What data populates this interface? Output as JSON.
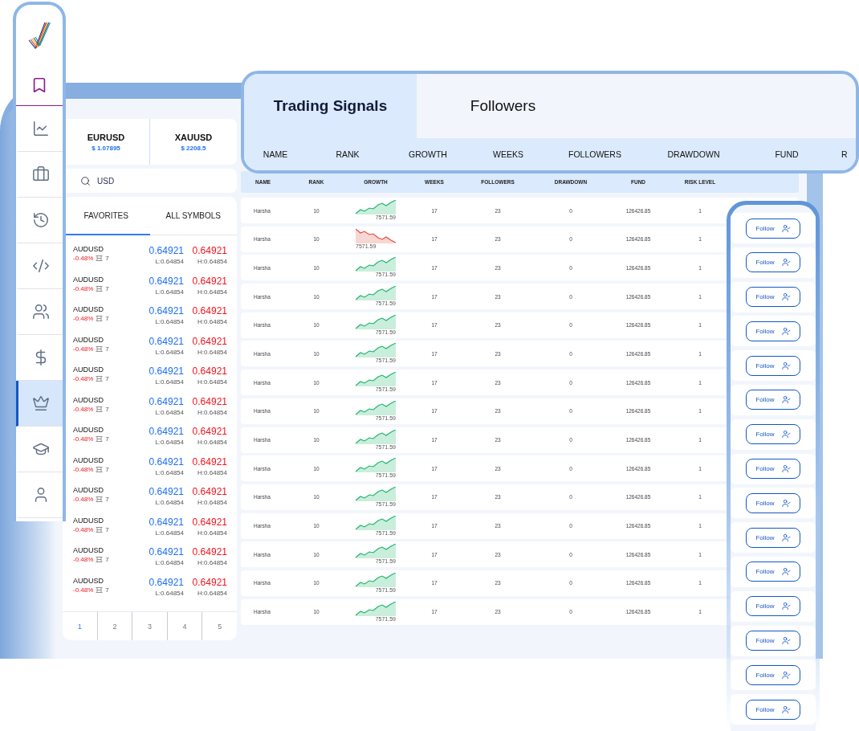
{
  "sidebar": {
    "items": [
      {
        "selected": false
      },
      {
        "selected": false
      },
      {
        "selected": false
      },
      {
        "selected": false
      },
      {
        "selected": false
      },
      {
        "selected": false
      },
      {
        "selected": true
      },
      {
        "selected": false
      },
      {
        "selected": false
      }
    ]
  },
  "quotes": [
    {
      "symbol": "EURUSD",
      "price": "$ 1.07895"
    },
    {
      "symbol": "XAUUSD",
      "price": "$ 2208.5"
    }
  ],
  "search": {
    "value": "USD"
  },
  "symbol_tabs": [
    {
      "label": "FAVORITES",
      "selected": true
    },
    {
      "label": "ALL SYMBOLS",
      "selected": false
    }
  ],
  "symbols": [
    {
      "symbol": "AUDUSD",
      "change": "-0.48%",
      "spread": "7",
      "bid": "0.64921",
      "ask": "0.64921",
      "low": "L:0.64854",
      "high": "H:0.64854"
    },
    {
      "symbol": "AUDUSD",
      "change": "-0.48%",
      "spread": "7",
      "bid": "0.64921",
      "ask": "0.64921",
      "low": "L:0.64854",
      "high": "H:0.64854"
    },
    {
      "symbol": "AUDUSD",
      "change": "-0.48%",
      "spread": "7",
      "bid": "0.64921",
      "ask": "0.64921",
      "low": "L:0.64854",
      "high": "H:0.64854"
    },
    {
      "symbol": "AUDUSD",
      "change": "-0.48%",
      "spread": "7",
      "bid": "0.64921",
      "ask": "0.64921",
      "low": "L:0.64854",
      "high": "H:0.64854"
    },
    {
      "symbol": "AUDUSD",
      "change": "-0.48%",
      "spread": "7",
      "bid": "0.64921",
      "ask": "0.64921",
      "low": "L:0.64854",
      "high": "H:0.64854"
    },
    {
      "symbol": "AUDUSD",
      "change": "-0.48%",
      "spread": "7",
      "bid": "0.64921",
      "ask": "0.64921",
      "low": "L:0.64854",
      "high": "H:0.64854"
    },
    {
      "symbol": "AUDUSD",
      "change": "-0.48%",
      "spread": "7",
      "bid": "0.64921",
      "ask": "0.64921",
      "low": "L:0.64854",
      "high": "H:0.64854"
    },
    {
      "symbol": "AUDUSD",
      "change": "-0.48%",
      "spread": "7",
      "bid": "0.64921",
      "ask": "0.64921",
      "low": "L:0.64854",
      "high": "H:0.64854"
    },
    {
      "symbol": "AUDUSD",
      "change": "-0.48%",
      "spread": "7",
      "bid": "0.64921",
      "ask": "0.64921",
      "low": "L:0.64854",
      "high": "H:0.64854"
    },
    {
      "symbol": "AUDUSD",
      "change": "-0.48%",
      "spread": "7",
      "bid": "0.64921",
      "ask": "0.64921",
      "low": "L:0.64854",
      "high": "H:0.64854"
    },
    {
      "symbol": "AUDUSD",
      "change": "-0.48%",
      "spread": "7",
      "bid": "0.64921",
      "ask": "0.64921",
      "low": "L:0.64854",
      "high": "H:0.64854"
    },
    {
      "symbol": "AUDUSD",
      "change": "-0.48%",
      "spread": "7",
      "bid": "0.64921",
      "ask": "0.64921",
      "low": "L:0.64854",
      "high": "H:0.64854"
    }
  ],
  "pagination": [
    {
      "label": "1",
      "selected": true
    },
    {
      "label": "2",
      "selected": false
    },
    {
      "label": "3",
      "selected": false
    },
    {
      "label": "4",
      "selected": false
    },
    {
      "label": "5",
      "selected": false
    }
  ],
  "signal_tabs": [
    {
      "label": "Trading Signals",
      "selected": true
    },
    {
      "label": "Followers",
      "selected": false
    }
  ],
  "overlay_columns": [
    "NAME",
    "RANK",
    "GROWTH",
    "WEEKS",
    "FOLLOWERS",
    "DRAWDOWN",
    "FUND",
    "R"
  ],
  "table": {
    "columns": [
      "NAME",
      "RANK",
      "GROWTH",
      "WEEKS",
      "FOLLOWERS",
      "DRAWDOWN",
      "FUND",
      "RISK LEVEL"
    ],
    "rows": [
      {
        "name": "Harsha",
        "rank": "10",
        "growth": "7571.59",
        "kind": "up",
        "weeks": "17",
        "followers": "23",
        "drawdown": "0",
        "fund": "126426.85",
        "risk_level": "1"
      },
      {
        "name": "Harsha",
        "rank": "10",
        "growth": "7571.59",
        "kind": "down",
        "weeks": "17",
        "followers": "23",
        "drawdown": "0",
        "fund": "126426.85",
        "risk_level": "1"
      },
      {
        "name": "Harsha",
        "rank": "10",
        "growth": "7571.59",
        "kind": "up",
        "weeks": "17",
        "followers": "23",
        "drawdown": "0",
        "fund": "126426.85",
        "risk_level": "1"
      },
      {
        "name": "Harsha",
        "rank": "10",
        "growth": "7571.59",
        "kind": "up",
        "weeks": "17",
        "followers": "23",
        "drawdown": "0",
        "fund": "126426.85",
        "risk_level": "1"
      },
      {
        "name": "Harsha",
        "rank": "10",
        "growth": "7571.59",
        "kind": "up",
        "weeks": "17",
        "followers": "23",
        "drawdown": "0",
        "fund": "126426.85",
        "risk_level": "1"
      },
      {
        "name": "Harsha",
        "rank": "10",
        "growth": "7571.59",
        "kind": "up",
        "weeks": "17",
        "followers": "23",
        "drawdown": "0",
        "fund": "126426.85",
        "risk_level": "1"
      },
      {
        "name": "Harsha",
        "rank": "10",
        "growth": "7571.59",
        "kind": "up",
        "weeks": "17",
        "followers": "23",
        "drawdown": "0",
        "fund": "126426.85",
        "risk_level": "1"
      },
      {
        "name": "Harsha",
        "rank": "10",
        "growth": "7571.59",
        "kind": "up",
        "weeks": "17",
        "followers": "23",
        "drawdown": "0",
        "fund": "126426.85",
        "risk_level": "1"
      },
      {
        "name": "Harsha",
        "rank": "10",
        "growth": "7571.59",
        "kind": "up",
        "weeks": "17",
        "followers": "23",
        "drawdown": "0",
        "fund": "126426.85",
        "risk_level": "1"
      },
      {
        "name": "Harsha",
        "rank": "10",
        "growth": "7571.59",
        "kind": "up",
        "weeks": "17",
        "followers": "23",
        "drawdown": "0",
        "fund": "126426.85",
        "risk_level": "1"
      },
      {
        "name": "Harsha",
        "rank": "10",
        "growth": "7571.59",
        "kind": "up",
        "weeks": "17",
        "followers": "23",
        "drawdown": "0",
        "fund": "126426.85",
        "risk_level": "1"
      },
      {
        "name": "Harsha",
        "rank": "10",
        "growth": "7571.59",
        "kind": "up",
        "weeks": "17",
        "followers": "23",
        "drawdown": "0",
        "fund": "126426.85",
        "risk_level": "1"
      },
      {
        "name": "Harsha",
        "rank": "10",
        "growth": "7571.59",
        "kind": "up",
        "weeks": "17",
        "followers": "23",
        "drawdown": "0",
        "fund": "126426.85",
        "risk_level": "1"
      },
      {
        "name": "Harsha",
        "rank": "10",
        "growth": "7571.59",
        "kind": "up",
        "weeks": "17",
        "followers": "23",
        "drawdown": "0",
        "fund": "126426.85",
        "risk_level": "1"
      },
      {
        "name": "Harsha",
        "rank": "10",
        "growth": "7571.59",
        "kind": "up",
        "weeks": "17",
        "followers": "23",
        "drawdown": "0",
        "fund": "126426.85",
        "risk_level": "1"
      }
    ]
  },
  "follow_buttons": [
    {
      "label": "Follow"
    },
    {
      "label": "Follow"
    },
    {
      "label": "Follow"
    },
    {
      "label": "Follow"
    },
    {
      "label": "Follow"
    },
    {
      "label": "Follow"
    },
    {
      "label": "Follow"
    },
    {
      "label": "Follow"
    },
    {
      "label": "Follow"
    },
    {
      "label": "Follow"
    },
    {
      "label": "Follow"
    },
    {
      "label": "Follow"
    },
    {
      "label": "Follow"
    },
    {
      "label": "Follow"
    },
    {
      "label": "Follow"
    }
  ]
}
